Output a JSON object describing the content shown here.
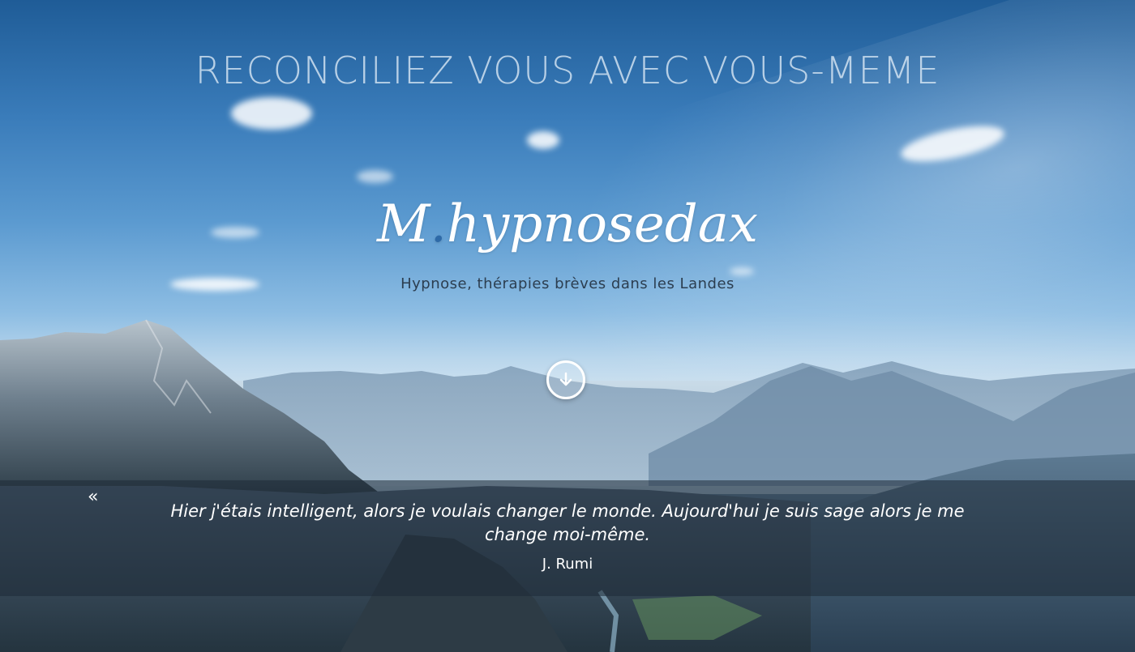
{
  "hero": {
    "headline": "RECONCILIEZ VOUS AVEC VOUS-MEME",
    "logo_initial": "M",
    "logo_dot": ".",
    "logo_name": "hypnosedax",
    "tagline": "Hypnose, thérapies brèves dans les Landes",
    "scroll_icon": "arrow-down-circle-icon"
  },
  "quote": {
    "mark": "«",
    "text": "Hier j'étais intelligent, alors je voulais changer le monde. Aujourd'hui je suis sage alors je me change moi-même.",
    "author": "J. Rumi"
  },
  "colors": {
    "accent": "#2e6aa8",
    "tagline": "#2c3e50",
    "band": "rgba(30,42,55,0.55)"
  }
}
